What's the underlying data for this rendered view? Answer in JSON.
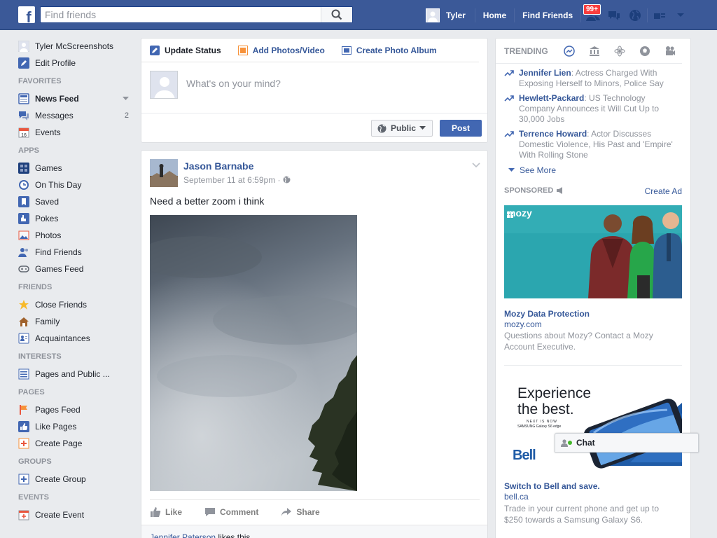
{
  "topbar": {
    "logo": "f",
    "search_placeholder": "Find friends",
    "user_name": "Tyler",
    "home_label": "Home",
    "find_friends_label": "Find Friends",
    "friend_requests_badge": "99+"
  },
  "leftnav": {
    "profile_name": "Tyler McScreenshots",
    "edit_profile": "Edit Profile",
    "favorites_head": "FAVORITES",
    "favorites": [
      {
        "label": "News Feed"
      },
      {
        "label": "Messages",
        "count": "2"
      },
      {
        "label": "Events"
      }
    ],
    "apps_head": "APPS",
    "apps": [
      {
        "label": "Games"
      },
      {
        "label": "On This Day"
      },
      {
        "label": "Saved"
      },
      {
        "label": "Pokes"
      },
      {
        "label": "Photos"
      },
      {
        "label": "Find Friends"
      },
      {
        "label": "Games Feed"
      }
    ],
    "friends_head": "FRIENDS",
    "friends": [
      {
        "label": "Close Friends"
      },
      {
        "label": "Family"
      },
      {
        "label": "Acquaintances"
      }
    ],
    "interests_head": "INTERESTS",
    "interests": [
      {
        "label": "Pages and Public ..."
      }
    ],
    "pages_head": "PAGES",
    "pages": [
      {
        "label": "Pages Feed"
      },
      {
        "label": "Like Pages"
      },
      {
        "label": "Create Page"
      }
    ],
    "groups_head": "GROUPS",
    "groups": [
      {
        "label": "Create Group"
      }
    ],
    "events_head": "EVENTS",
    "events": [
      {
        "label": "Create Event"
      }
    ]
  },
  "composer": {
    "tab_status": "Update Status",
    "tab_photos": "Add Photos/Video",
    "tab_album": "Create Photo Album",
    "placeholder": "What's on your mind?",
    "privacy": "Public",
    "post_button": "Post"
  },
  "post": {
    "author": "Jason Barnabe",
    "time": "September 11 at 6:59pm",
    "text": "Need a better zoom i think",
    "like": "Like",
    "comment": "Comment",
    "share": "Share",
    "liker": "Jennifer Paterson",
    "likes_suffix": " likes this."
  },
  "trending": {
    "title": "TRENDING",
    "items": [
      {
        "topic": "Jennifer Lien",
        "desc": ": Actress Charged With Exposing Herself to Minors, Police Say"
      },
      {
        "topic": "Hewlett-Packard",
        "desc": ": US Technology Company Announces it Will Cut Up to 30,000 Jobs"
      },
      {
        "topic": "Terrence Howard",
        "desc": ": Actor Discusses Domestic Violence, His Past and 'Empire' With Rolling Stone"
      }
    ],
    "see_more": "See More"
  },
  "sponsored": {
    "label": "SPONSORED",
    "create_ad": "Create Ad",
    "ads": [
      {
        "logo": "mozy",
        "title": "Mozy Data Protection",
        "url": "mozy.com",
        "desc": "Questions about Mozy? Contact a Mozy Account Executive."
      },
      {
        "headline_1": "Experience",
        "headline_2": "the best.",
        "small_1": "NEXT IS NOW",
        "small_2": "SAMSUNG Galaxy S6 edge",
        "brand": "Bell",
        "title": "Switch to Bell and save.",
        "url": "bell.ca",
        "desc": "Trade in your current phone and get up to $250 towards a Samsung Galaxy S6."
      }
    ]
  },
  "chat": {
    "label": "Chat"
  },
  "colors": {
    "brand": "#3b5998",
    "link": "#365899",
    "button": "#4267b2",
    "badge": "#fa3e3e",
    "online": "#42b72a"
  }
}
